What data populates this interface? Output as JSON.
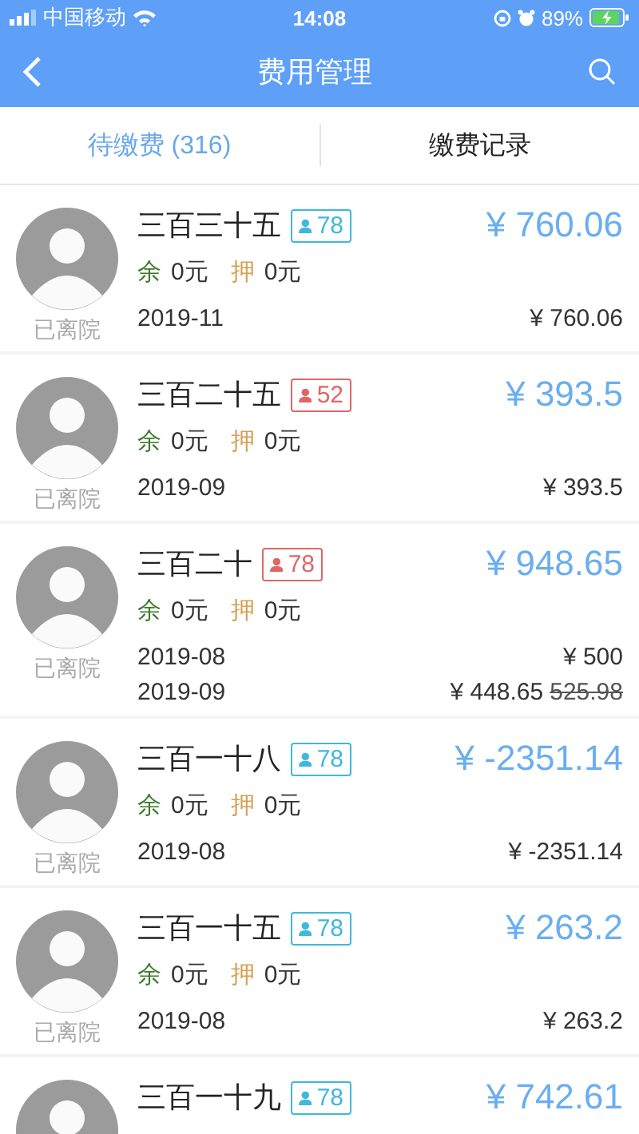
{
  "status_bar": {
    "carrier": "中国移动",
    "time": "14:08",
    "battery": "89%"
  },
  "nav": {
    "title": "费用管理"
  },
  "tabs": [
    {
      "label": "待缴费 (316)",
      "selected": true
    },
    {
      "label": "缴费记录",
      "selected": false
    }
  ],
  "patients": [
    {
      "name": "三百三十五",
      "tag": "78",
      "color": "#3fb8dc",
      "status": "已离院",
      "total": "¥ 760.06",
      "balance_label": "余",
      "balance": "0元",
      "deposit_label": "押",
      "deposit": "0元",
      "bills": [
        {
          "month": "2019-11",
          "amount": "¥ 760.06"
        }
      ]
    },
    {
      "name": "三百二十五",
      "tag": "52",
      "color": "#e06666",
      "status": "已离院",
      "total": "¥ 393.5",
      "balance_label": "余",
      "balance": "0元",
      "deposit_label": "押",
      "deposit": "0元",
      "bills": [
        {
          "month": "2019-09",
          "amount": "¥ 393.5"
        }
      ]
    },
    {
      "name": "三百二十",
      "tag": "78",
      "color": "#e06666",
      "status": "已离院",
      "total": "¥ 948.65",
      "balance_label": "余",
      "balance": "0元",
      "deposit_label": "押",
      "deposit": "0元",
      "bills": [
        {
          "month": "2019-08",
          "amount": "¥ 500"
        },
        {
          "month": "2019-09",
          "amount": "¥ 448.65",
          "original": "525.98"
        }
      ]
    },
    {
      "name": "三百一十八",
      "tag": "78",
      "color": "#3fb8dc",
      "status": "已离院",
      "total": "¥ -2351.14",
      "balance_label": "余",
      "balance": "0元",
      "deposit_label": "押",
      "deposit": "0元",
      "bills": [
        {
          "month": "2019-08",
          "amount": "¥ -2351.14"
        }
      ]
    },
    {
      "name": "三百一十五",
      "tag": "78",
      "color": "#3fb8dc",
      "status": "已离院",
      "total": "¥ 263.2",
      "balance_label": "余",
      "balance": "0元",
      "deposit_label": "押",
      "deposit": "0元",
      "bills": [
        {
          "month": "2019-08",
          "amount": "¥ 263.2"
        }
      ]
    },
    {
      "name": "三百一十九",
      "tag": "78",
      "color": "#3fb8dc",
      "total": "¥ 742.61"
    }
  ]
}
